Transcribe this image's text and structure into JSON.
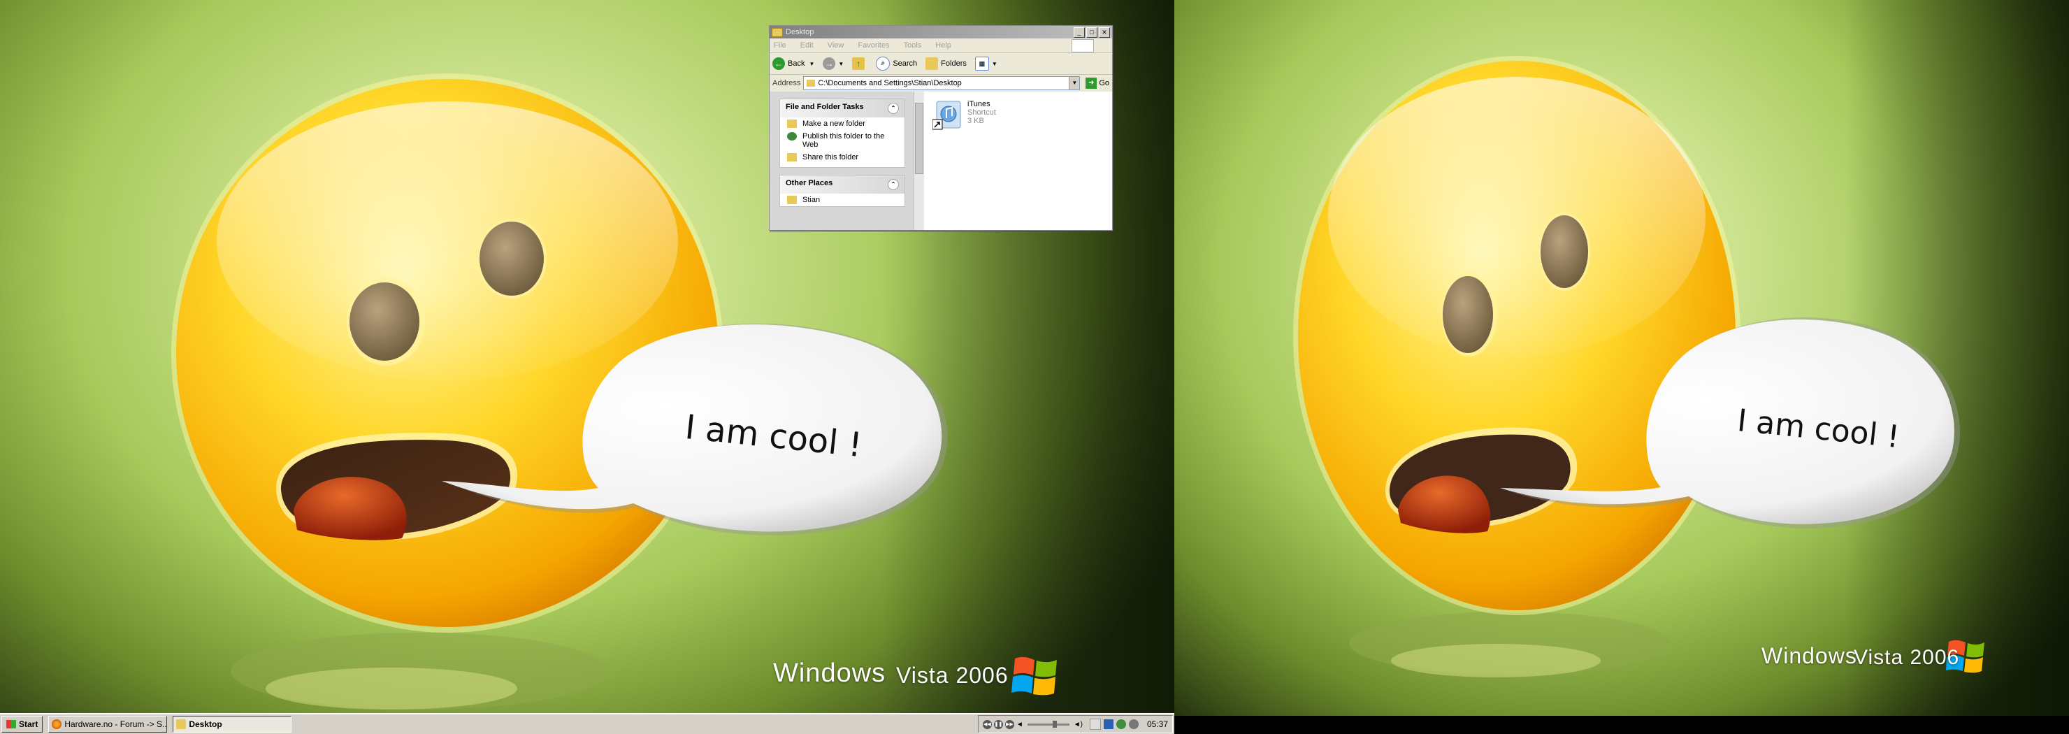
{
  "wallpaper": {
    "speech_text": "I am cool !",
    "brand": "Windows",
    "brand_version": "Vista 2006"
  },
  "explorer": {
    "title": "Desktop",
    "menu": [
      "File",
      "Edit",
      "View",
      "Favorites",
      "Tools",
      "Help"
    ],
    "toolbar": {
      "back": "Back",
      "search": "Search",
      "folders": "Folders"
    },
    "address_label": "Address",
    "address_value": "C:\\Documents and Settings\\Stian\\Desktop",
    "go_label": "Go",
    "tasks_panel": {
      "title": "File and Folder Tasks",
      "items": [
        "Make a new folder",
        "Publish this folder to the Web",
        "Share this folder"
      ]
    },
    "places_panel": {
      "title": "Other Places",
      "items": [
        "Stian"
      ]
    },
    "file": {
      "name": "iTunes",
      "type": "Shortcut",
      "size": "3 KB"
    }
  },
  "taskbar": {
    "start_label": "Start",
    "tasks": [
      "Hardware.no - Forum -> S...",
      "Desktop"
    ],
    "clock": "05:37"
  }
}
